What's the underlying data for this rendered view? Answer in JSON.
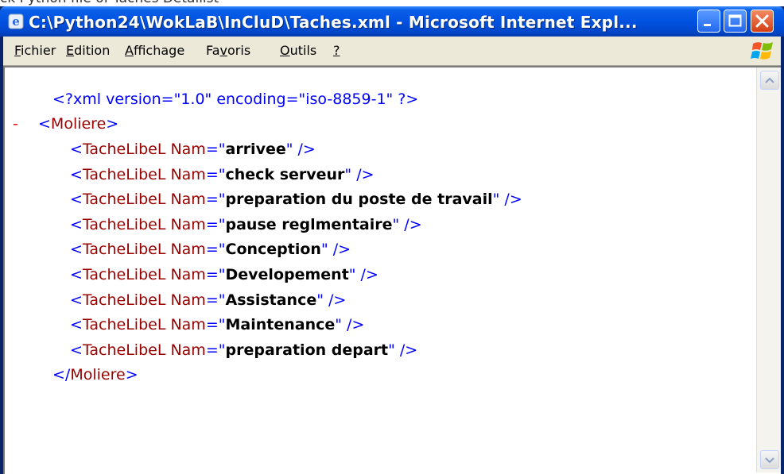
{
  "caption_above": "ck Python file of Taches Detailist",
  "window": {
    "title": "C:\\Python24\\WokLaB\\InCluD\\Taches.xml - Microsoft Internet Expl...",
    "app_icon": "ie-icon",
    "controls": [
      "minimize",
      "maximize",
      "close"
    ]
  },
  "menu": {
    "items": [
      {
        "accel": "F",
        "rest": "ichier"
      },
      {
        "accel": "E",
        "rest": "dition"
      },
      {
        "accel": "A",
        "rest": "ffichage"
      },
      {
        "pre": "Fa",
        "accel": "v",
        "rest": "oris"
      },
      {
        "accel": "O",
        "rest": "utils"
      },
      {
        "accel": "?",
        "rest": ""
      }
    ]
  },
  "xml": {
    "declaration": "<?xml version=\"1.0\" encoding=\"iso-8859-1\" ?>",
    "collapse_marker": "-",
    "root_open": "Moliere",
    "root_close": "Moliere",
    "element": "TacheLibeL",
    "attr": "Nam",
    "entries": [
      "arrivee",
      "check serveur",
      "preparation du poste de travail",
      "pause reglmentaire",
      "Conception",
      "Developement",
      "Assistance",
      "Maintenance",
      "preparation depart"
    ]
  },
  "colors": {
    "titlebar": "#0050e0",
    "markup": "#0000ff",
    "tag_name": "#990000",
    "collapse": "#ff0000"
  }
}
